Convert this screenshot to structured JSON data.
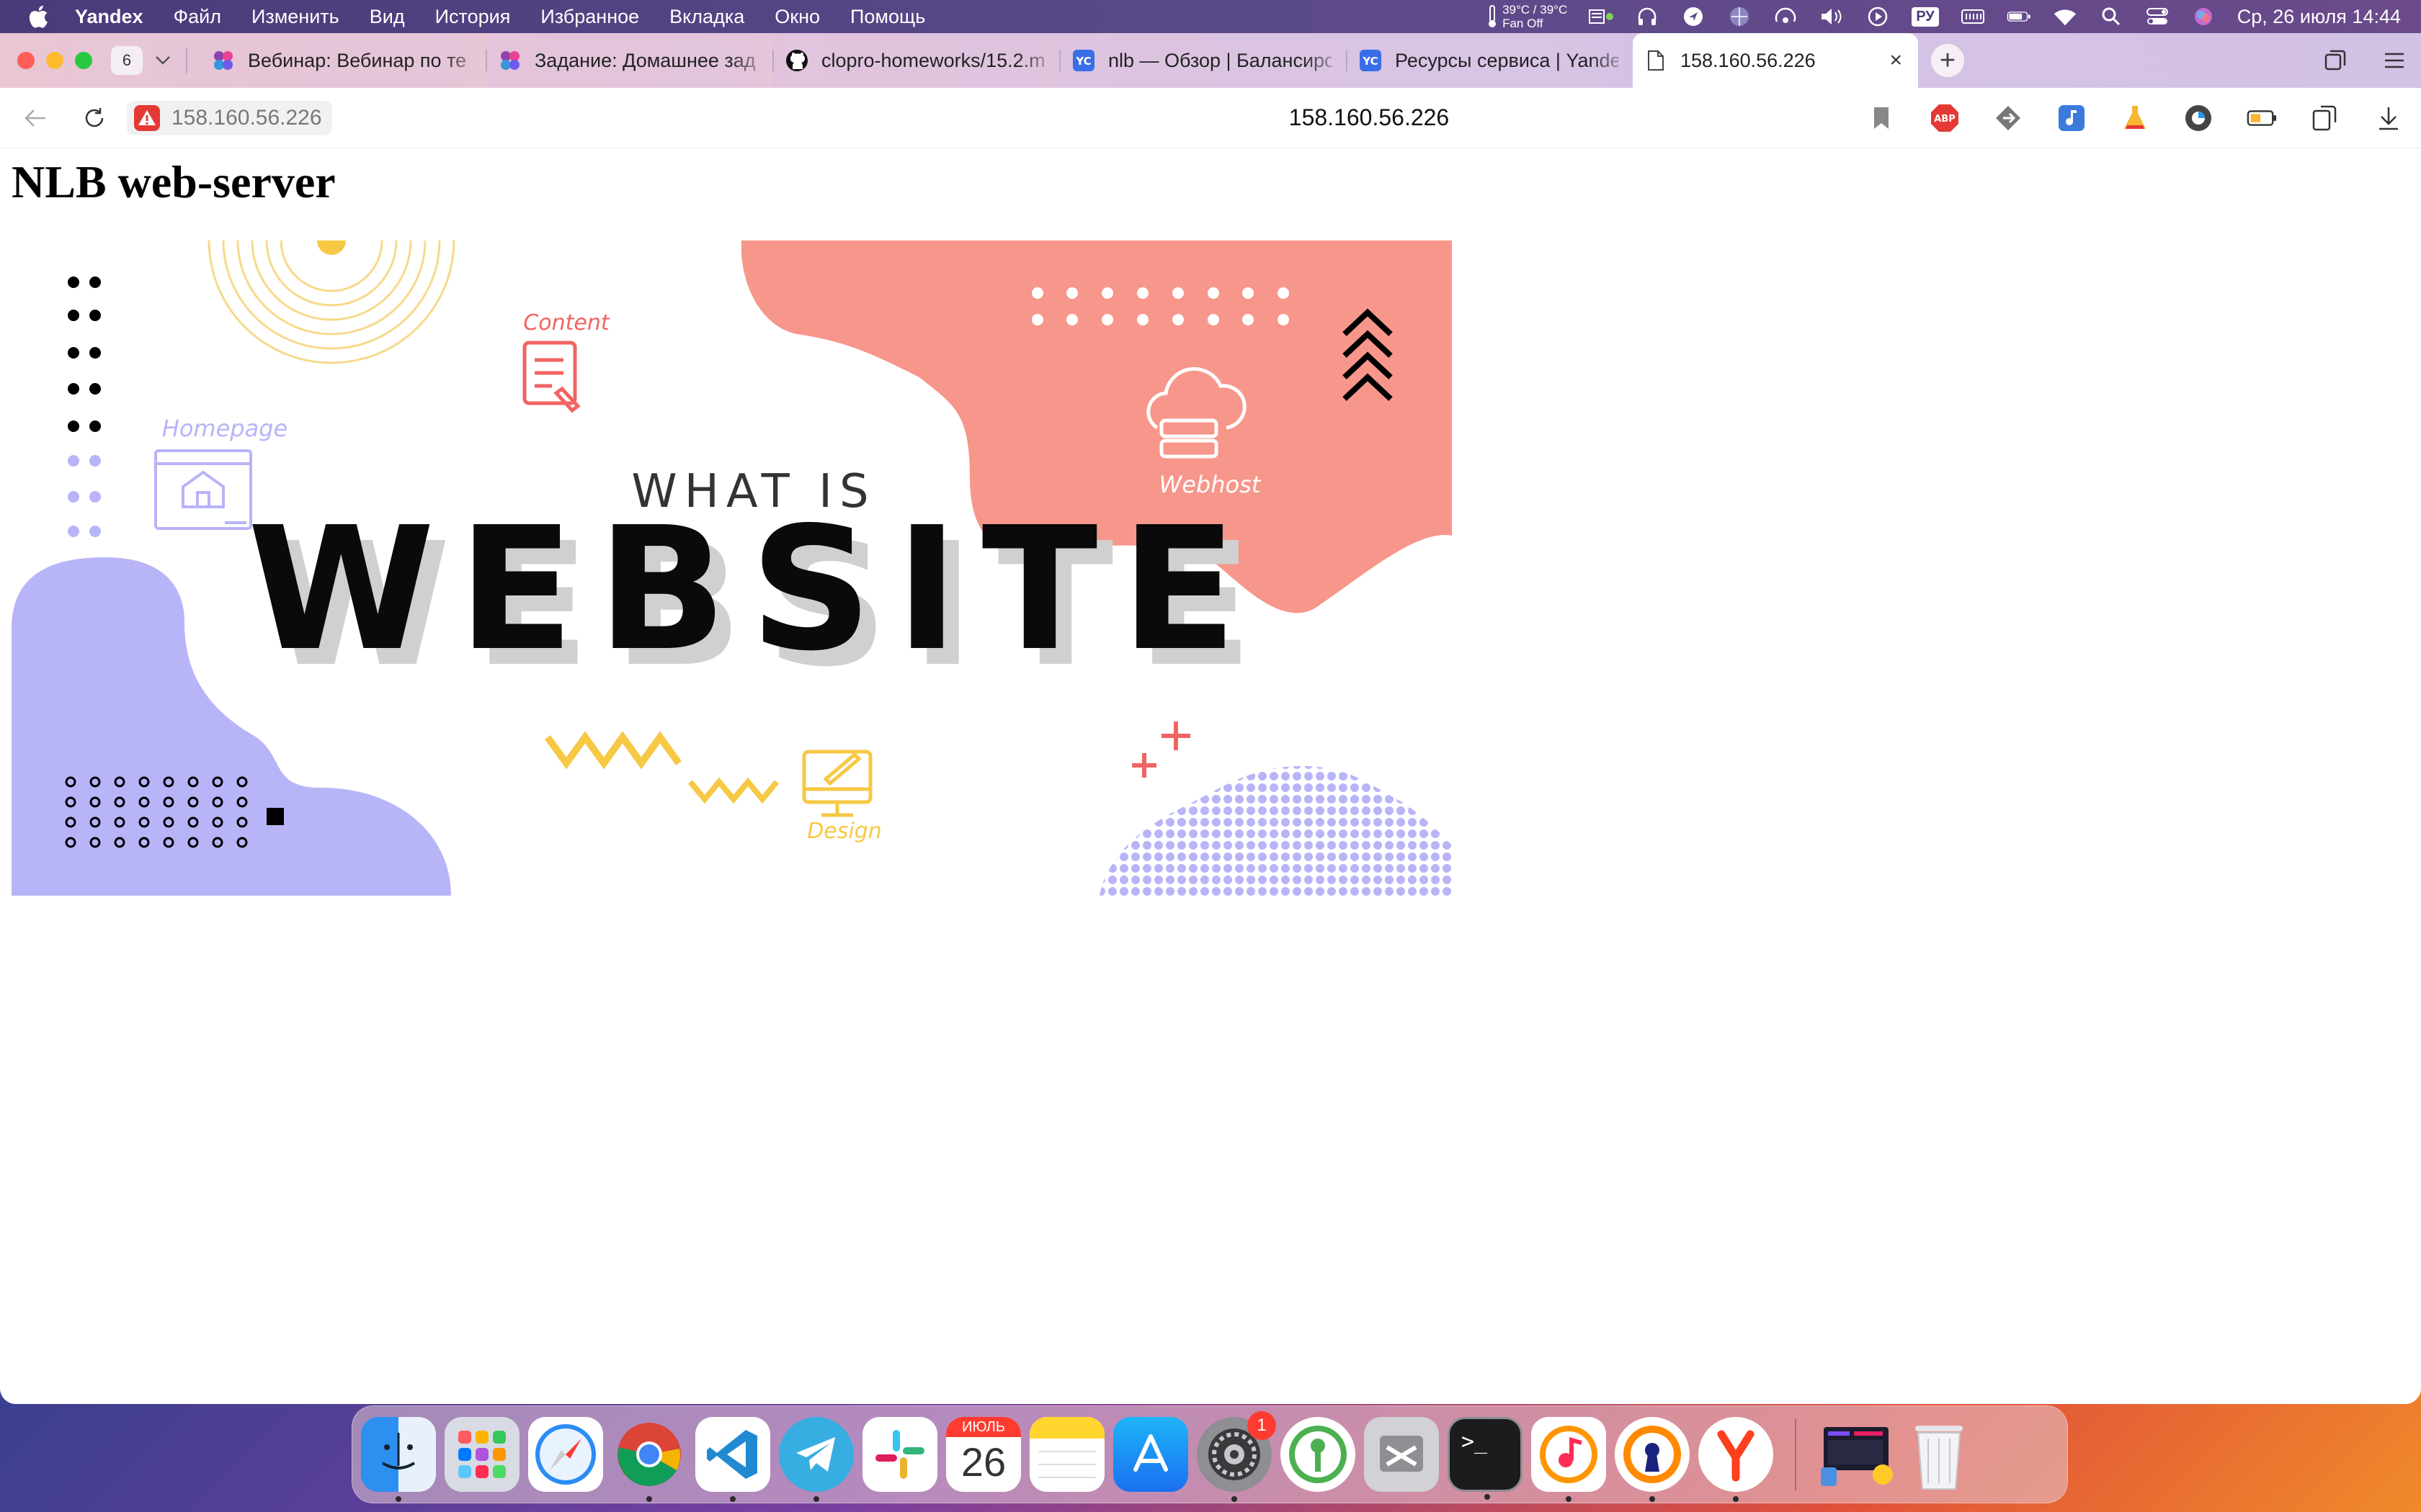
{
  "menubar": {
    "app_name": "Yandex",
    "items": [
      "Файл",
      "Изменить",
      "Вид",
      "История",
      "Избранное",
      "Вкладка",
      "Окно",
      "Помощь"
    ],
    "temp_line1": "39°C / 39°C",
    "temp_line2": "Fan Off",
    "input_lang": "РУ",
    "clock": "Ср, 26 июля  14:44",
    "tray_icons": [
      "thermometer-icon",
      "stats-icon",
      "headphones-icon",
      "location-icon",
      "vpn-icon",
      "airplay-icon",
      "volume-icon",
      "play-icon",
      "keyboard-icon",
      "battery-icon",
      "wifi-icon",
      "spotlight-icon",
      "control-center-icon",
      "siri-icon"
    ]
  },
  "tabs": {
    "count": "6",
    "items": [
      {
        "title": "Вебинар: Вебинар по те",
        "icon": "netology-icon",
        "active": false
      },
      {
        "title": "Задание: Домашнее зад",
        "icon": "netology-icon",
        "active": false
      },
      {
        "title": "clopro-homeworks/15.2.m",
        "icon": "github-icon",
        "active": false
      },
      {
        "title": "nlb — Обзор | Балансиро",
        "icon": "yandex-cloud-icon",
        "active": false
      },
      {
        "title": "Ресурсы сервиса | Yande",
        "icon": "yandex-cloud-icon",
        "active": false
      },
      {
        "title": "158.160.56.226",
        "icon": "page-icon",
        "active": true
      }
    ]
  },
  "address": {
    "host_chip": "158.160.56.226",
    "center_title": "158.160.56.226"
  },
  "page": {
    "heading": "NLB web-server"
  },
  "hero": {
    "small_title": "WHAT IS",
    "big_title": "WEBSITE",
    "labels": {
      "content": "Content",
      "homepage": "Homepage",
      "webhost": "Webhost",
      "design": "Design"
    }
  },
  "colors": {
    "coral": "#f7968a",
    "lavender": "#b8b4f8",
    "yellow": "#f7c844",
    "accent_red": "#f26363"
  },
  "dock": {
    "apps": [
      "finder-icon",
      "launchpad-icon",
      "safari-icon",
      "chrome-icon",
      "vscode-icon",
      "telegram-icon",
      "slack-icon",
      "calendar-icon",
      "notes-icon",
      "app-store-icon",
      "system-settings-icon",
      "keepassxc-icon",
      "utility-icon",
      "terminal-icon",
      "music-icon",
      "vpn-client-icon",
      "yandex-browser-icon"
    ],
    "calendar_month": "ИЮЛЬ",
    "calendar_day": "26",
    "settings_badge": "1",
    "terminal_prompt": ">_"
  }
}
